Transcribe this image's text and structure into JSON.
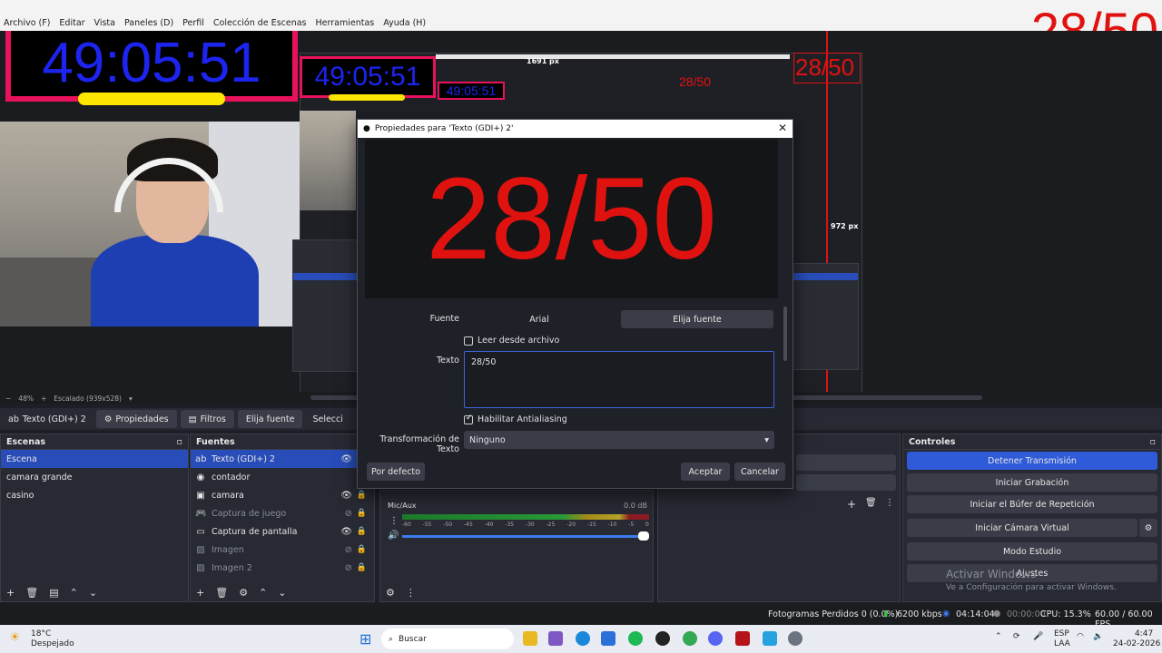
{
  "menu": [
    "Archivo (F)",
    "Editar",
    "Vista",
    "Paneles (D)",
    "Perfil",
    "Colección de Escenas",
    "Herramientas",
    "Ayuda (H)"
  ],
  "overlay": {
    "timer": "49:05:51",
    "counter": "28/50",
    "dim_width": "1691 px",
    "dim_height": "972 px"
  },
  "zoom": {
    "minus": "−",
    "value": "48%",
    "plus": "+",
    "scale": "Escalado (939x528)"
  },
  "toolbar": {
    "source_name": "Texto (GDI+) 2",
    "properties": "Propiedades",
    "filters": "Filtros",
    "choose_font": "Elija fuente",
    "select": "Selecci"
  },
  "scenes": {
    "title": "Escenas",
    "items": [
      "Escena",
      "camara grande",
      "casino"
    ]
  },
  "sources": {
    "title": "Fuentes",
    "items": [
      {
        "label": "Texto (GDI+) 2",
        "icon": "text-icon"
      },
      {
        "label": "contador",
        "icon": "browser-icon"
      },
      {
        "label": "camara",
        "icon": "camera-icon"
      },
      {
        "label": "Captura de juego",
        "icon": "gamepad-icon"
      },
      {
        "label": "Captura de pantalla",
        "icon": "monitor-icon"
      },
      {
        "label": "Imagen",
        "icon": "image-icon"
      },
      {
        "label": "Imagen 2",
        "icon": "image-icon"
      }
    ]
  },
  "mixer": {
    "channel": "Mic/Aux",
    "db": "0.0 dB",
    "ticks": [
      "-60",
      "-55",
      "-50",
      "-45",
      "-40",
      "-35",
      "-30",
      "-25",
      "-20",
      "-15",
      "-10",
      "-5",
      "0"
    ]
  },
  "controls": {
    "title": "Controles",
    "buttons": [
      "Detener Transmisión",
      "Iniciar Grabación",
      "Iniciar el Búfer de Repetición",
      "Iniciar Cámara Virtual",
      "Modo Estudio",
      "Ajustes"
    ]
  },
  "watermark": {
    "line1": "Activar Windows",
    "line2": "Ve a Configuración para activar Windows."
  },
  "dialog": {
    "title": "Propiedades para 'Texto (GDI+) 2'",
    "preview_text": "28/50",
    "font_label": "Fuente",
    "font_value": "Arial",
    "choose_font": "Elija fuente",
    "read_from_file": "Leer desde archivo",
    "text_label": "Texto",
    "text_value": "28/50",
    "antialias": "Habilitar Antialiasing",
    "transform_label": "Transformación de Texto",
    "transform_value": "Ninguno",
    "defaults": "Por defecto",
    "accept": "Aceptar",
    "cancel": "Cancelar"
  },
  "status": {
    "dropped": "Fotogramas Perdidos 0 (0.0%)",
    "bitrate": "6200 kbps",
    "live": "04:14:04",
    "rec": "00:00:00",
    "cpu": "CPU: 15.3%",
    "fps": "60.00 / 60.00 FPS"
  },
  "taskbar": {
    "temp": "18°C",
    "weather": "Despejado",
    "search": "Buscar",
    "lang1": "ESP",
    "lang2": "LAA",
    "time": "4:47",
    "date": "24-02-2026"
  },
  "colors": {
    "accent": "#284cb8",
    "red": "#e0120f",
    "timer_blue": "#1d24f0",
    "timer_border": "#e8125c"
  }
}
